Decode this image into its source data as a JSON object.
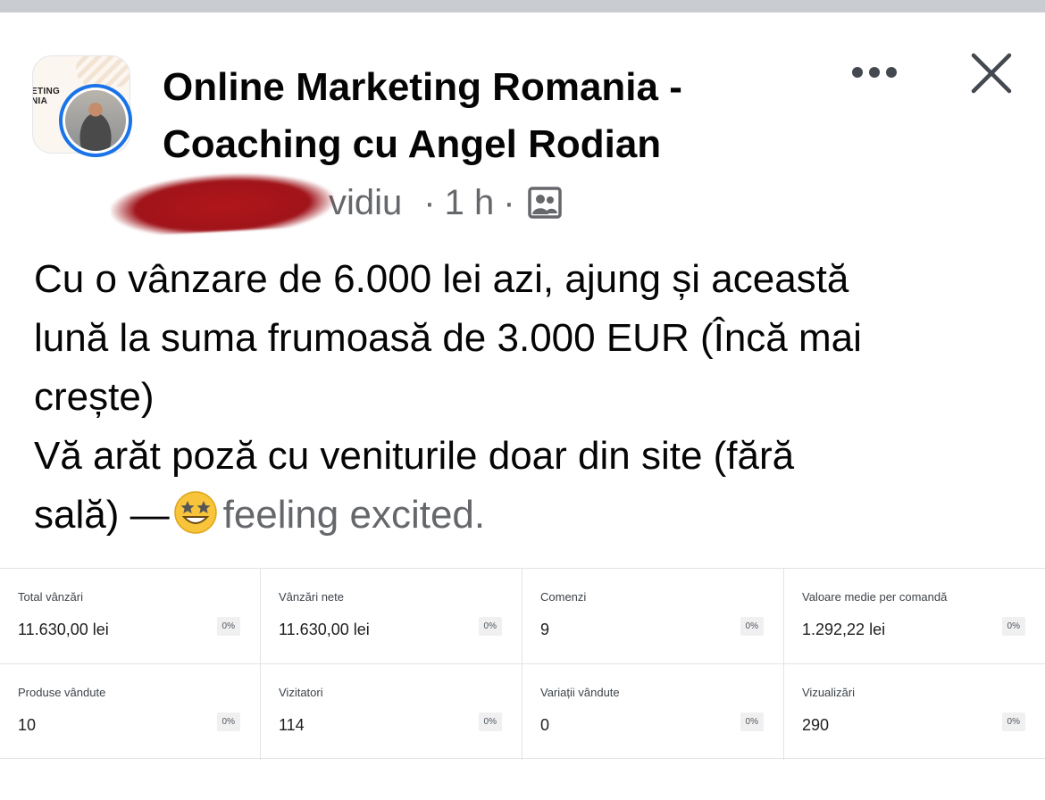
{
  "header": {
    "group_logo_text": "ETING\nNIA",
    "group_name": "Online Marketing Romania - Coaching cu Angel Rodian",
    "author_visible": "vidiu",
    "time": "1 h",
    "separator": "·"
  },
  "post": {
    "lines": [
      "Cu o vânzare de 6.000 lei azi, ajung și această",
      "lună la suma frumoasă de 3.000 EUR (Încă mai",
      "crește)",
      "Vă arăt poză cu veniturile doar din site (fără"
    ],
    "last_line_prefix": "sală) —",
    "feeling": "feeling excited."
  },
  "stats": [
    {
      "label": "Total vânzări",
      "value": "11.630,00 lei",
      "change": "0%"
    },
    {
      "label": "Vânzări nete",
      "value": "11.630,00 lei",
      "change": "0%"
    },
    {
      "label": "Comenzi",
      "value": "9",
      "change": "0%"
    },
    {
      "label": "Valoare medie per comandă",
      "value": "1.292,22 lei",
      "change": "0%"
    },
    {
      "label": "Produse vândute",
      "value": "10",
      "change": "0%"
    },
    {
      "label": "Vizitatori",
      "value": "114",
      "change": "0%"
    },
    {
      "label": "Variații vândute",
      "value": "0",
      "change": "0%"
    },
    {
      "label": "Vizualizări",
      "value": "290",
      "change": "0%"
    }
  ],
  "icons": {
    "more": "more-horizontal-icon",
    "close": "close-icon",
    "privacy": "group-members-icon",
    "emoji": "star-struck-emoji"
  },
  "colors": {
    "avatar_ring": "#1a73e8",
    "secondary_text": "#65676b",
    "redaction": "#a0141a"
  }
}
